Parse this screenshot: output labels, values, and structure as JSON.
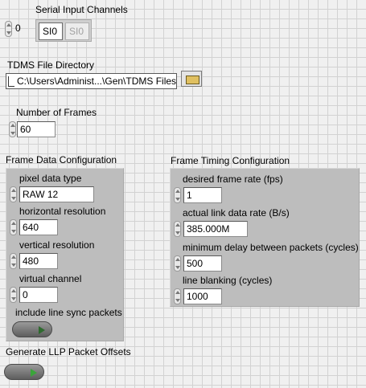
{
  "serial": {
    "label": "Serial Input Channels",
    "index_value": "0",
    "channels": [
      "SI0",
      "SI0"
    ]
  },
  "tdms": {
    "label": "TDMS File Directory",
    "path": "C:\\Users\\Administ...\\Gen\\TDMS Files"
  },
  "frames": {
    "label": "Number of Frames",
    "value": "60"
  },
  "frame_data": {
    "title": "Frame Data Configuration",
    "pixel_type_label": "pixel data type",
    "pixel_type_value": "RAW 12",
    "hres_label": "horizontal resolution",
    "hres_value": "640",
    "vres_label": "vertical resolution",
    "vres_value": "480",
    "vchan_label": "virtual channel",
    "vchan_value": "0",
    "line_sync_label": "include line sync packets"
  },
  "frame_timing": {
    "title": "Frame Timing Configuration",
    "fps_label": "desired frame rate (fps)",
    "fps_value": "1",
    "link_rate_label": "actual link data rate (B/s)",
    "link_rate_value": "385.000M",
    "min_delay_label": "minimum delay between packets (cycles)",
    "min_delay_value": "500",
    "blanking_label": "line blanking (cycles)",
    "blanking_value": "1000"
  },
  "llp": {
    "label": "Generate LLP Packet Offsets"
  }
}
